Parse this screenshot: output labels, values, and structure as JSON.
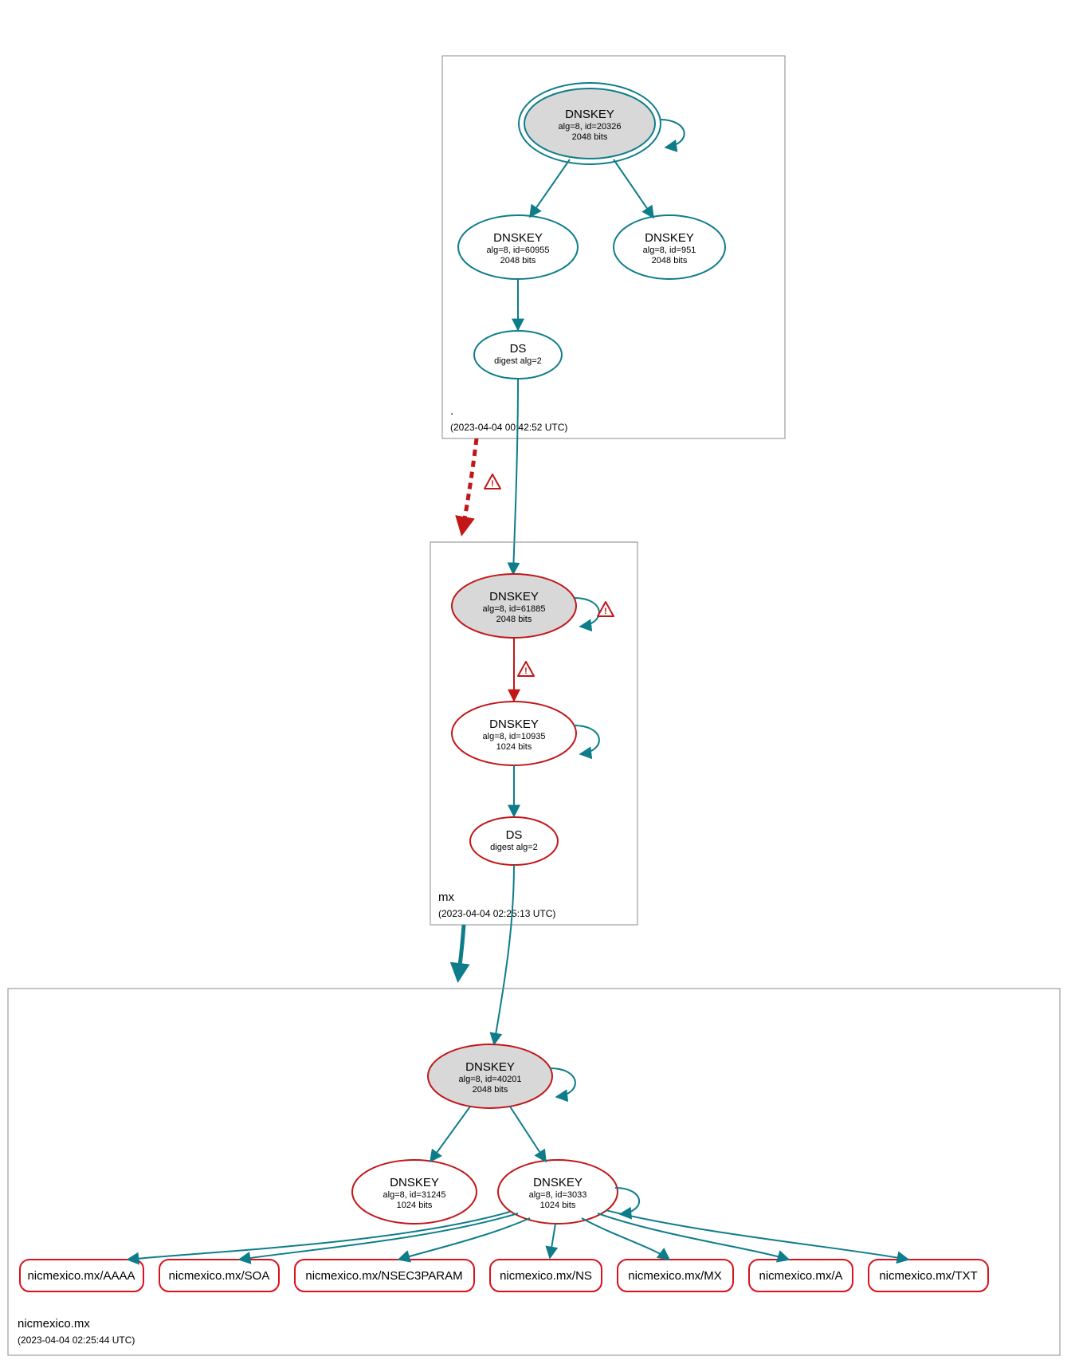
{
  "zones": {
    "root": {
      "name": ".",
      "timestamp": "(2023-04-04 00:42:52 UTC)"
    },
    "mx": {
      "name": "mx",
      "timestamp": "(2023-04-04 02:25:13 UTC)"
    },
    "nicmexico": {
      "name": "nicmexico.mx",
      "timestamp": "(2023-04-04 02:25:44 UTC)"
    }
  },
  "nodes": {
    "root_ksk": {
      "title": "DNSKEY",
      "alg": "alg=8, id=20326",
      "bits": "2048 bits"
    },
    "root_zsk1": {
      "title": "DNSKEY",
      "alg": "alg=8, id=60955",
      "bits": "2048 bits"
    },
    "root_zsk2": {
      "title": "DNSKEY",
      "alg": "alg=8, id=951",
      "bits": "2048 bits"
    },
    "root_ds": {
      "title": "DS",
      "alg": "digest alg=2"
    },
    "mx_ksk": {
      "title": "DNSKEY",
      "alg": "alg=8, id=61885",
      "bits": "2048 bits"
    },
    "mx_zsk": {
      "title": "DNSKEY",
      "alg": "alg=8, id=10935",
      "bits": "1024 bits"
    },
    "mx_ds": {
      "title": "DS",
      "alg": "digest alg=2"
    },
    "nic_ksk": {
      "title": "DNSKEY",
      "alg": "alg=8, id=40201",
      "bits": "2048 bits"
    },
    "nic_zsk1": {
      "title": "DNSKEY",
      "alg": "alg=8, id=31245",
      "bits": "1024 bits"
    },
    "nic_zsk2": {
      "title": "DNSKEY",
      "alg": "alg=8, id=3033",
      "bits": "1024 bits"
    }
  },
  "rrsets": {
    "aaaa": "nicmexico.mx/AAAA",
    "soa": "nicmexico.mx/SOA",
    "nsec3": "nicmexico.mx/NSEC3PARAM",
    "ns": "nicmexico.mx/NS",
    "mx": "nicmexico.mx/MX",
    "a": "nicmexico.mx/A",
    "txt": "nicmexico.mx/TXT"
  },
  "colors": {
    "teal": "#0e7d8a",
    "red": "#c21617",
    "grey": "#d8d8d8"
  }
}
